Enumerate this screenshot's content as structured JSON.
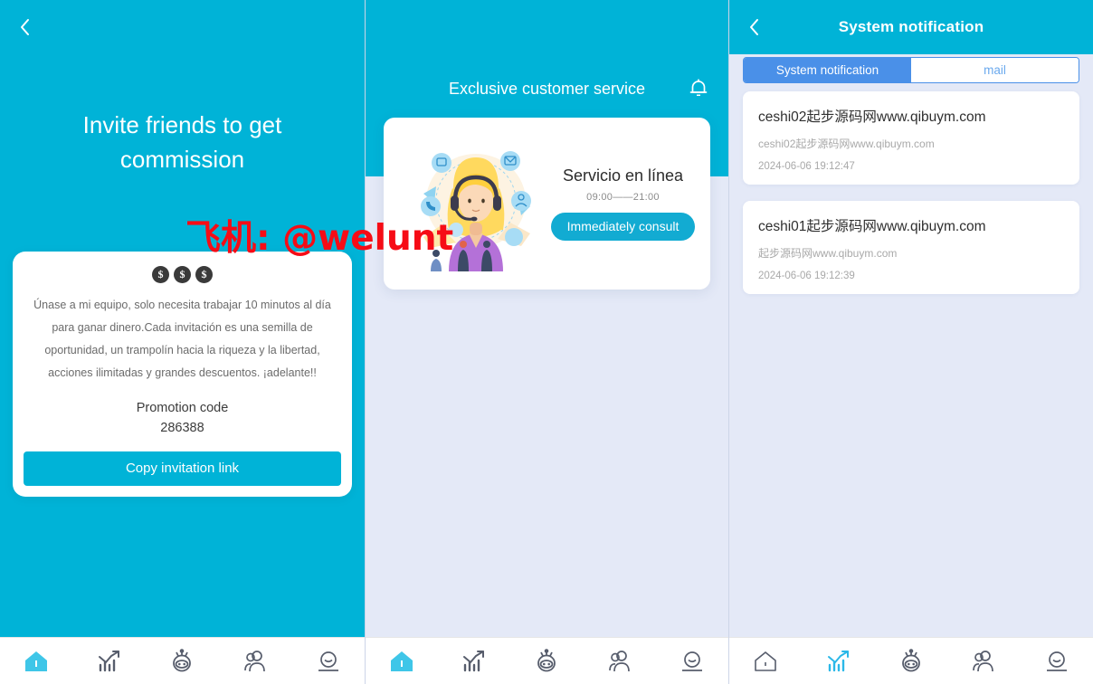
{
  "theme": {
    "cyan": "#00b3d7",
    "blue_tab": "#4a90e8",
    "page_bg": "#e4e9f7",
    "watermark_red": "#f60c16"
  },
  "watermark": {
    "text": "飞机: @welunt"
  },
  "panel_invite": {
    "header": {
      "back_icon": "chevron-left-icon"
    },
    "hero_title": "Invite friends to get commission",
    "card": {
      "coins": [
        "$",
        "$",
        "$"
      ],
      "description": "Únase a mi equipo, solo necesita trabajar 10 minutos al día para ganar dinero.Cada invitación es una semilla de oportunidad, un trampolín hacia la riqueza y la libertad, acciones ilimitadas y grandes descuentos. ¡adelante!!",
      "promo_label": "Promotion code",
      "promo_code": "286388",
      "copy_button": "Copy invitation link"
    }
  },
  "panel_service": {
    "header": {
      "bell_icon": "bell-icon"
    },
    "hero_title": "Exclusive customer service",
    "card": {
      "illustration": "customer-service-agent-illustration",
      "name": "Servicio en línea",
      "hours": "09:00——21:00",
      "button": "Immediately consult"
    }
  },
  "panel_notification": {
    "header": {
      "back_icon": "chevron-left-icon",
      "title": "System notification"
    },
    "tabs": [
      {
        "label": "System notification",
        "active": true
      },
      {
        "label": "mail",
        "active": false
      }
    ],
    "items": [
      {
        "title": "ceshi02起步源码网www.qibuym.com",
        "subtitle": "ceshi02起步源码网www.qibuym.com",
        "time": "2024-06-06 19:12:47"
      },
      {
        "title": "ceshi01起步源码网www.qibuym.com",
        "subtitle": "起步源码网www.qibuym.com",
        "time": "2024-06-06 19:12:39"
      }
    ]
  },
  "tabbar": {
    "items": [
      {
        "icon": "home-icon",
        "name": "home"
      },
      {
        "icon": "chart-trend-icon",
        "name": "market"
      },
      {
        "icon": "robot-icon",
        "name": "robot"
      },
      {
        "icon": "users-group-icon",
        "name": "team"
      },
      {
        "icon": "person-profile-icon",
        "name": "profile"
      }
    ],
    "active_index_panel_1": 0,
    "active_index_panel_2": 0,
    "active_index_panel_3": 1
  }
}
